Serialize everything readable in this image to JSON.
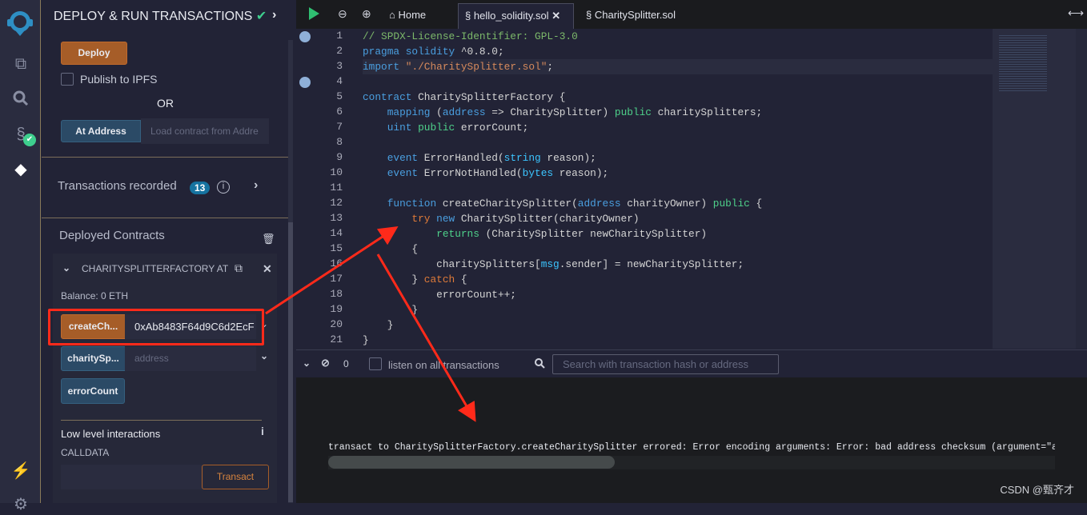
{
  "sidebar": {
    "title": "DEPLOY & RUN TRANSACTIONS",
    "deploy": "Deploy",
    "publish_ipfs": "Publish to IPFS",
    "or": "OR",
    "at_address": "At Address",
    "at_address_placeholder": "Load contract from Addre",
    "transactions_recorded": "Transactions recorded",
    "tx_count": "13",
    "deployed_contracts": "Deployed Contracts",
    "contract_name": "CHARITYSPLITTERFACTORY AT",
    "balance": "Balance: 0 ETH",
    "functions": [
      {
        "label": "createCh...",
        "value": "0xAb8483F64d9C6d2EcF",
        "color": "orange"
      },
      {
        "label": "charitySp...",
        "placeholder": "address",
        "color": "blue"
      },
      {
        "label": "errorCount",
        "color": "blue"
      }
    ],
    "low_level": "Low level interactions",
    "calldata": "CALLDATA",
    "transact": "Transact"
  },
  "tabs": [
    {
      "label": "Home",
      "icon": "home-icon"
    },
    {
      "label": "hello_solidity.sol",
      "icon": "solidity-icon",
      "active": true
    },
    {
      "label": "CharitySplitter.sol",
      "icon": "solidity-icon"
    }
  ],
  "code": [
    [
      [
        "// SPDX-License-Identifier: GPL-3.0",
        "c"
      ]
    ],
    [
      [
        "pragma solidity ",
        "k"
      ],
      [
        "^0.8.0;",
        "t"
      ]
    ],
    [
      [
        "import ",
        "k"
      ],
      [
        "\"./CharitySplitter.sol\"",
        "s"
      ],
      [
        ";",
        "t"
      ]
    ],
    [],
    [
      [
        "contract ",
        "k"
      ],
      [
        "CharitySplitterFactory {",
        "t"
      ]
    ],
    [
      [
        "    mapping ",
        "k"
      ],
      [
        "(",
        "t"
      ],
      [
        "address",
        "k"
      ],
      [
        " => CharitySplitter) ",
        "t"
      ],
      [
        "public ",
        "g"
      ],
      [
        "charitySplitters;",
        "t"
      ]
    ],
    [
      [
        "    uint ",
        "k"
      ],
      [
        "public ",
        "g"
      ],
      [
        "errorCount;",
        "t"
      ]
    ],
    [],
    [
      [
        "    event ",
        "k"
      ],
      [
        "ErrorHandled(",
        "t"
      ],
      [
        "string",
        "y"
      ],
      [
        " reason);",
        "t"
      ]
    ],
    [
      [
        "    event ",
        "k"
      ],
      [
        "ErrorNotHandled(",
        "t"
      ],
      [
        "bytes",
        "y"
      ],
      [
        " reason);",
        "t"
      ]
    ],
    [],
    [
      [
        "    function ",
        "k"
      ],
      [
        "createCharitySplitter(",
        "t"
      ],
      [
        "address",
        "k"
      ],
      [
        " charityOwner) ",
        "t"
      ],
      [
        "public ",
        "g"
      ],
      [
        "{",
        "t"
      ]
    ],
    [
      [
        "        try ",
        "o"
      ],
      [
        "new ",
        "k"
      ],
      [
        "CharitySplitter(charityOwner)",
        "t"
      ]
    ],
    [
      [
        "            returns ",
        "g"
      ],
      [
        "(CharitySplitter newCharitySplitter)",
        "t"
      ]
    ],
    [
      [
        "        {",
        "t"
      ]
    ],
    [
      [
        "            charitySplitters[",
        "t"
      ],
      [
        "msg",
        "y"
      ],
      [
        ".sender] = newCharitySplitter;",
        "t"
      ]
    ],
    [
      [
        "        } ",
        "t"
      ],
      [
        "catch ",
        "o"
      ],
      [
        "{",
        "t"
      ]
    ],
    [
      [
        "            errorCount++;",
        "t"
      ]
    ],
    [
      [
        "        }",
        "t"
      ]
    ],
    [
      [
        "    }",
        "t"
      ]
    ],
    [
      [
        "}",
        "t"
      ]
    ]
  ],
  "breakpoints": [
    1,
    4
  ],
  "terminal": {
    "count": "0",
    "listen": "listen on all transactions",
    "search_placeholder": "Search with transaction hash or address",
    "message": "transact to CharitySplitterFactory.createCharitySplitter errored: Error encoding arguments: Error: bad address checksum (argument=\"address"
  },
  "watermark": "CSDN @甄齐才",
  "colors": {
    "accent_orange": "#a65d28",
    "accent_blue": "#2b4a66",
    "annotation_red": "#ff2a1a",
    "success": "#3ecf8e"
  }
}
